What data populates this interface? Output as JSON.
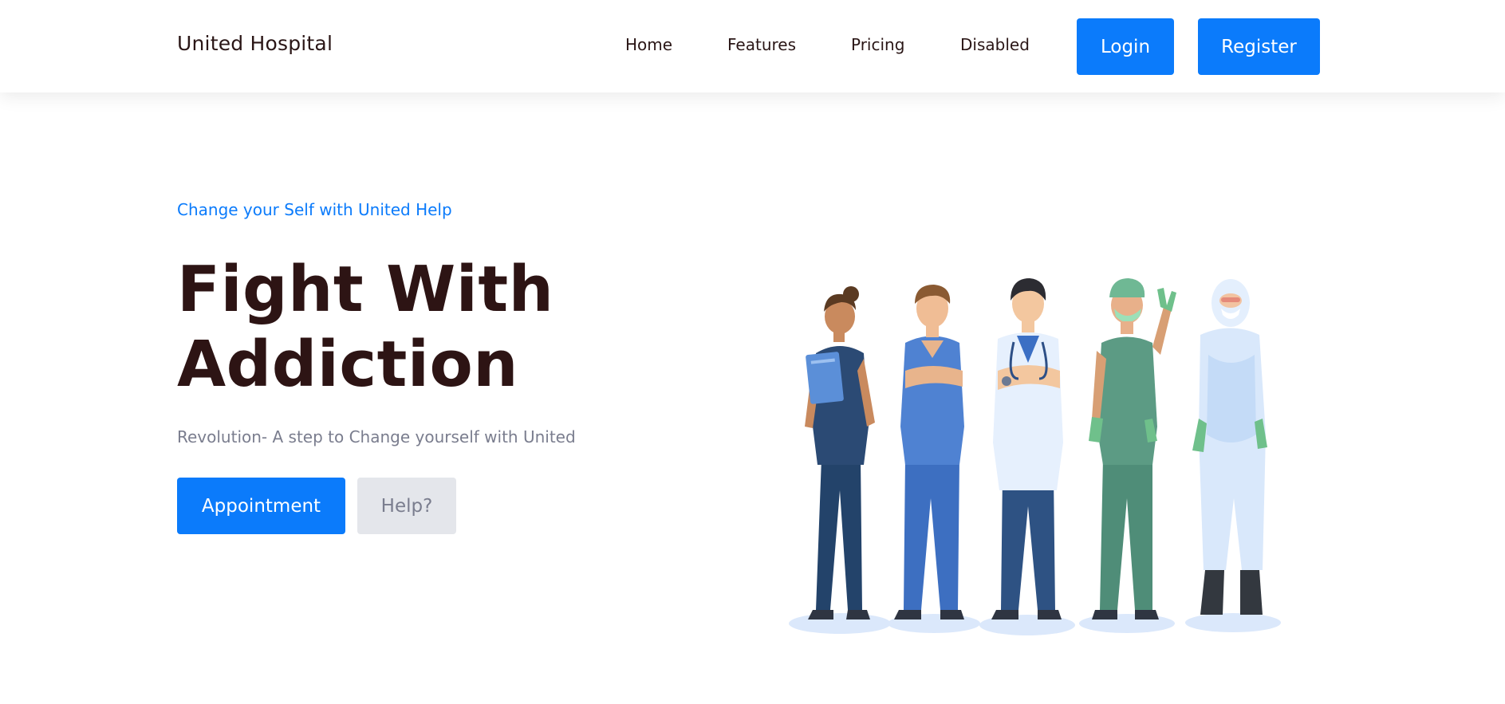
{
  "navbar": {
    "brand": "United Hospital",
    "links": [
      "Home",
      "Features",
      "Pricing",
      "Disabled"
    ],
    "login_label": "Login",
    "register_label": "Register"
  },
  "hero": {
    "eyebrow": "Change your Self with United Help",
    "title_line1": "Fight With",
    "title_line2": "Addiction",
    "subtitle": "Revolution- A step to Change yourself with United",
    "appointment_label": "Appointment",
    "help_label": "Help?"
  },
  "colors": {
    "accent": "#0b7bfb",
    "heading": "#2d1414",
    "muted": "#7a7d8e",
    "secondary_button_bg": "#e4e6eb"
  }
}
